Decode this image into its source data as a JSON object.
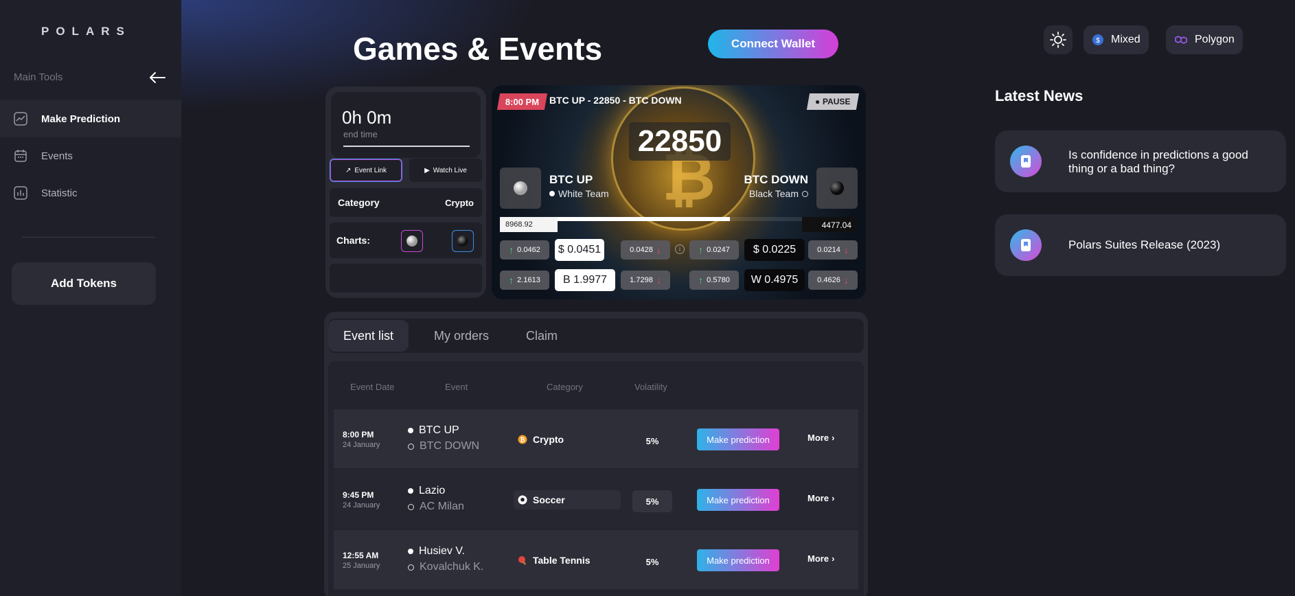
{
  "sidebar": {
    "logo": "POLARS",
    "section_label": "Main Tools",
    "items": [
      {
        "label": "Make Prediction",
        "icon": "chart-line-icon"
      },
      {
        "label": "Events",
        "icon": "calendar-icon"
      },
      {
        "label": "Statistic",
        "icon": "bar-chart-icon"
      }
    ],
    "add_tokens": "Add Tokens"
  },
  "header": {
    "title": "Games & Events",
    "connect_wallet": "Connect Wallet",
    "mode_chip": "Mixed",
    "network_chip": "Polygon"
  },
  "info_panel": {
    "timer": "0h 0m",
    "timer_label": "end time",
    "event_link": "Event Link",
    "watch_live": "Watch Live",
    "category_label": "Category",
    "category_value": "Crypto",
    "charts_label": "Charts:"
  },
  "event_card": {
    "time": "8:00 PM",
    "title": "BTC UP - 22850 - BTC DOWN",
    "status": "PAUSE",
    "price": "22850",
    "left_team": {
      "name": "BTC UP",
      "team": "White Team"
    },
    "right_team": {
      "name": "BTC DOWN",
      "team": "Black Team"
    },
    "left_pool": "8968.92",
    "right_pool": "4477.04",
    "progress": 0.67,
    "row1": {
      "l_up": "0.0462",
      "l_price": "$ 0.0451",
      "l_down": "0.0428",
      "r_up": "0.0247",
      "r_price": "$ 0.0225",
      "r_down": "0.0214"
    },
    "row2": {
      "l_up": "2.1613",
      "l_price": "B 1.9977",
      "l_down": "1.7298",
      "r_up": "0.5780",
      "r_price": "W 0.4975",
      "r_down": "0.4626"
    }
  },
  "tabs": [
    "Event list",
    "My orders",
    "Claim"
  ],
  "table": {
    "headers": [
      "Event Date",
      "Event",
      "Category",
      "Volatility"
    ],
    "rows": [
      {
        "time": "8:00 PM",
        "date": "24 January",
        "team1": "BTC UP",
        "team2": "BTC DOWN",
        "category": "Crypto",
        "category_icon": "bitcoin-icon",
        "volatility": "5%",
        "action": "Make prediction",
        "more": "More"
      },
      {
        "time": "9:45 PM",
        "date": "24 January",
        "team1": "Lazio",
        "team2": "AC Milan",
        "category": "Soccer",
        "category_icon": "soccer-ball-icon",
        "volatility": "5%",
        "action": "Make prediction",
        "more": "More"
      },
      {
        "time": "12:55 AM",
        "date": "25 January",
        "team1": "Husiev V.",
        "team2": "Kovalchuk K.",
        "category": "Table Tennis",
        "category_icon": "ping-pong-icon",
        "volatility": "5%",
        "action": "Make prediction",
        "more": "More"
      }
    ]
  },
  "news": {
    "title": "Latest News",
    "items": [
      {
        "text": "Is confidence in predictions a good thing or a bad thing?"
      },
      {
        "text": "Polars Suites Release (2023)"
      }
    ]
  },
  "colors": {
    "accent_gradient_start": "#1fb6e8",
    "accent_gradient_end": "#d43fd8",
    "time_tag": "#d9455a",
    "up": "#4cd47a",
    "down": "#e44a56"
  }
}
